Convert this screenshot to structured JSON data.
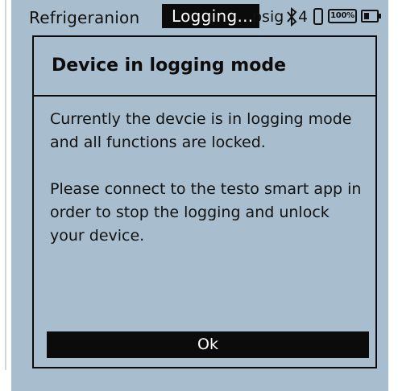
{
  "status_bar": {
    "app_name": "Refrigeranion",
    "mode_label": "Logging...",
    "unit": "psig",
    "bluetooth_count": "4",
    "battery_percent_label": "100%"
  },
  "dialog": {
    "title": "Device in logging mode",
    "paragraph_1": "Currently the devcie is in logging mode and all functions are locked.",
    "paragraph_2": "Please connect to the testo smart app in order to stop the logging and unlock your device.",
    "ok_label": "Ok"
  },
  "icons": {
    "bluetooth": "bluetooth-icon",
    "phone": "phone-icon",
    "battery_percent": "battery-percent-icon",
    "battery": "battery-icon"
  },
  "colors": {
    "screen_background": "#a8bece",
    "foreground": "#0c0c0c",
    "inverse_text": "#ffffff"
  }
}
